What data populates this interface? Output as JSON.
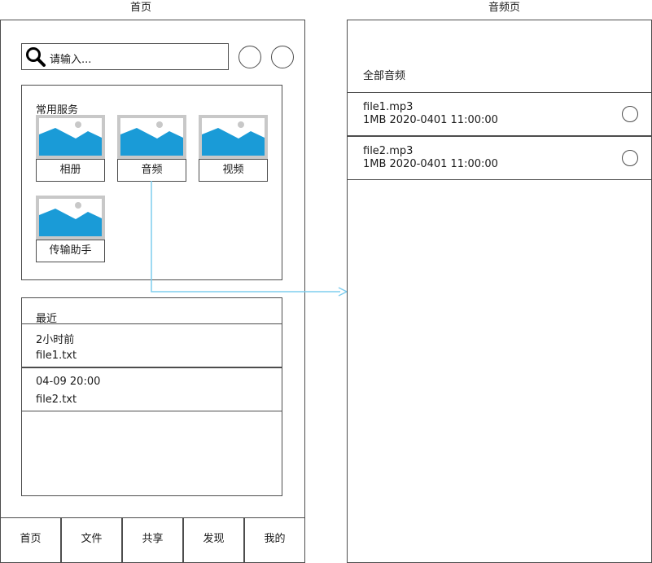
{
  "home": {
    "title": "首页",
    "search": {
      "placeholder": "请输入..."
    },
    "services": {
      "title": "常用服务",
      "items": [
        {
          "label": "相册",
          "icon": "image-icon"
        },
        {
          "label": "音频",
          "icon": "image-icon"
        },
        {
          "label": "视频",
          "icon": "image-icon"
        },
        {
          "label": "传输助手",
          "icon": "image-icon"
        }
      ]
    },
    "recent": {
      "title": "最近",
      "items": [
        {
          "time": "2小时前",
          "file": "file1.txt"
        },
        {
          "time": "04-09 20:00",
          "file": "file2.txt"
        }
      ]
    },
    "tabs": [
      "首页",
      "文件",
      "共享",
      "发现",
      "我的"
    ]
  },
  "audio": {
    "title": "音频页",
    "header": "全部音频",
    "files": [
      {
        "name": "file1.mp3",
        "meta": "1MB 2020-0401 11:00:00"
      },
      {
        "name": "file2.mp3",
        "meta": "1MB 2020-0401 11:00:00"
      }
    ]
  },
  "colors": {
    "accent": "#1a9bd7",
    "connector": "#7fcdee",
    "border": "#4d4d4d",
    "placeholder_frame": "#c8c8c8"
  }
}
